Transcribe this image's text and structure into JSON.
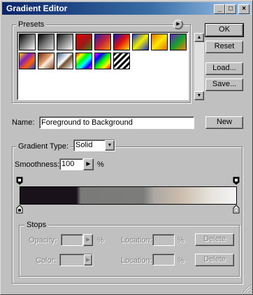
{
  "window": {
    "title": "Gradient Editor",
    "minimize_glyph": "_",
    "maximize_glyph": "□",
    "close_glyph": "×"
  },
  "presets": {
    "label": "Presets",
    "menu_glyph": "▶",
    "swatches": [
      {
        "name": "foreground-to-background",
        "css": "linear-gradient(135deg,#000 0%,#fff 100%)"
      },
      {
        "name": "foreground-to-transparent",
        "css": "linear-gradient(135deg,#000 0%,#777 50%,#ddd 100%)"
      },
      {
        "name": "black-white",
        "css": "linear-gradient(135deg,#111 0%,#fff 100%)"
      },
      {
        "name": "red-green",
        "css": "linear-gradient(135deg,#e00000 0%,#a01818 55%,#408020 100%)"
      },
      {
        "name": "violet-orange",
        "css": "linear-gradient(135deg,#2020a0 0%,#c02040 50%,#ff9000 100%)"
      },
      {
        "name": "blue-red-yellow",
        "css": "linear-gradient(135deg,#1010c0 0%,#e01010 50%,#ffe000 100%)"
      },
      {
        "name": "blue-yellow-blue",
        "css": "linear-gradient(135deg,#2030d0 0%,#f0f000 50%,#2030d0 100%)"
      },
      {
        "name": "orange-yellow-orange",
        "css": "linear-gradient(135deg,#e07000 0%,#ffe800 50%,#e07000 100%)"
      },
      {
        "name": "violet-green-orange",
        "css": "linear-gradient(135deg,#7020c0 0%,#10a030 50%,#ff8000 100%)"
      },
      {
        "name": "yellow-violet-orange-blue",
        "css": "linear-gradient(135deg,#ffd000 0%,#8020c0 35%,#ff6000 65%,#2040e0 100%)"
      },
      {
        "name": "copper",
        "css": "linear-gradient(135deg,#702810 0%,#e0a070 45%,#fff0e0 55%,#804020 100%)"
      },
      {
        "name": "chrome",
        "css": "linear-gradient(135deg,#406080 0%,#fff 45%,#705030 55%,#fff 100%)"
      },
      {
        "name": "spectrum",
        "css": "linear-gradient(135deg,#f00 0%,#ff0 20%,#0f0 40%,#0ff 60%,#00f 80%,#f0f 100%)"
      },
      {
        "name": "transparent-rainbow",
        "css": "linear-gradient(135deg,#f0f 0%,#00f 25%,#0f0 50%,#ff0 75%,#f00 100%)"
      },
      {
        "name": "transparent-stripes",
        "css": "repeating-linear-gradient(135deg,#000 0px,#000 3px,#fff 3px,#fff 6px)"
      }
    ]
  },
  "buttons": {
    "ok": "OK",
    "reset": "Reset",
    "load": "Load...",
    "save": "Save...",
    "new": "New"
  },
  "name_field": {
    "label": "Name:",
    "value": "Foreground to Background"
  },
  "gradient": {
    "type_label": "Gradient Type:",
    "type_value": "Solid",
    "smoothness_label": "Smoothness:",
    "smoothness_value": "100",
    "smoothness_unit": "%"
  },
  "stops": {
    "group_label": "Stops",
    "opacity_label": "Opacity:",
    "opacity_unit": "%",
    "color_label": "Color:",
    "location_label": "Location:",
    "location_unit": "%",
    "delete_label": "Delete"
  },
  "colors": {
    "title_start": "#0a246a",
    "title_end": "#a6caf0",
    "face": "#c0c0c0"
  }
}
